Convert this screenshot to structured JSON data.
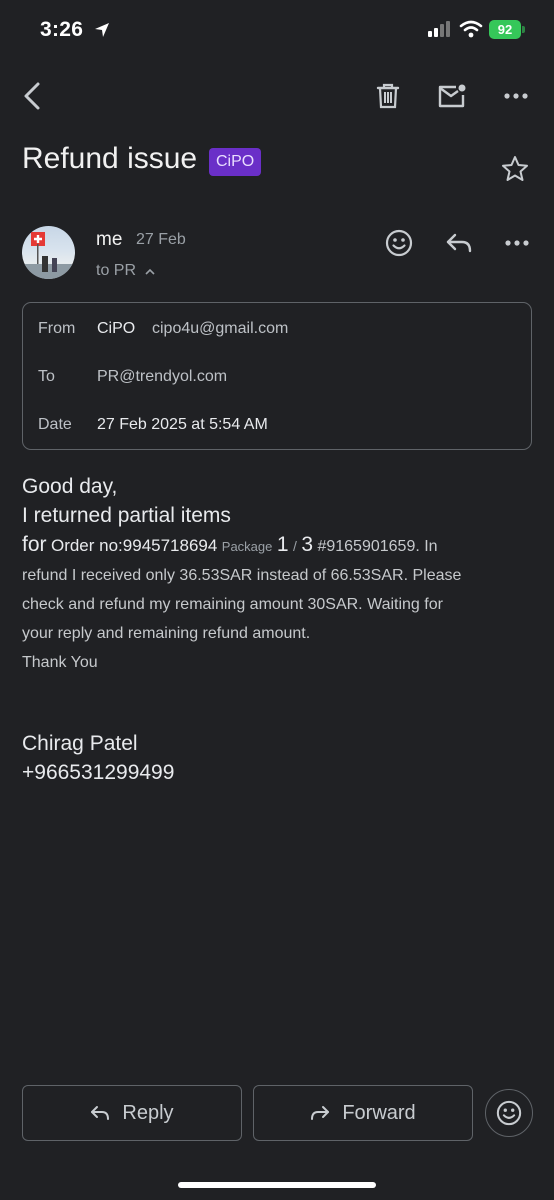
{
  "status_bar": {
    "time": "3:26",
    "battery": "92"
  },
  "email": {
    "subject": "Refund issue",
    "label": "CiPO",
    "sender": "me",
    "date": "27 Feb",
    "to_summary": "to PR",
    "details": {
      "from_label": "From",
      "from_name": "CiPO",
      "from_email": "cipo4u@gmail.com",
      "to_label": "To",
      "to_email": "PR@trendyol.com",
      "date_label": "Date",
      "date_value": "27 Feb 2025 at 5:54 AM"
    },
    "body": {
      "greeting": "Good day,",
      "line1": "I returned partial items",
      "for_word": "for",
      "order_text": "Order no:9945718694",
      "package_word": "Package",
      "package_num": "1",
      "package_sep": "/",
      "package_total": "3",
      "tail1": "#9165901659. In",
      "line3": "refund I received only 36.53SAR instead of 66.53SAR. Please",
      "line4": "check and refund my remaining amount 30SAR. Waiting for",
      "line5": "your reply and remaining refund amount.",
      "thanks": "Thank You"
    },
    "signature": {
      "name": "Chirag Patel",
      "phone": "+966531299499"
    }
  },
  "actions": {
    "reply": "Reply",
    "forward": "Forward"
  },
  "icons": {
    "back": "chevron-left-icon",
    "delete": "trash-icon",
    "mark_unread": "mail-unread-icon",
    "more": "more-horizontal-icon",
    "star": "star-icon",
    "emoji": "emoji-icon",
    "reply": "reply-icon",
    "forward": "forward-icon"
  },
  "colors": {
    "background": "#202124",
    "label_chip": "#6a2fc8",
    "battery": "#35c759"
  }
}
